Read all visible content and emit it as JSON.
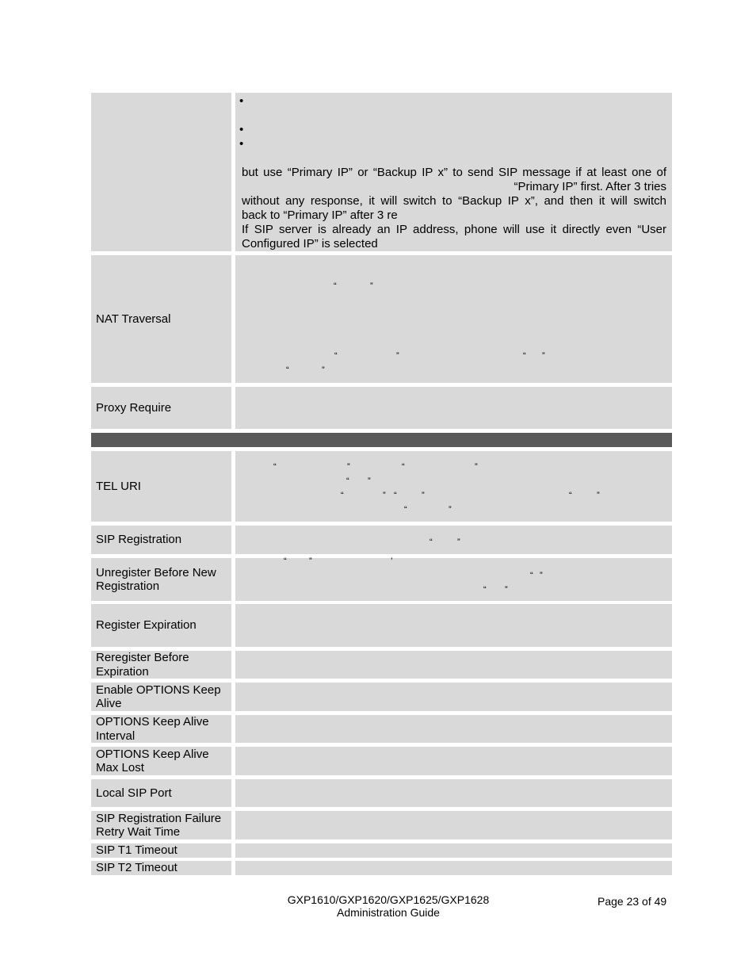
{
  "table": {
    "continuation_row": {
      "bullets": [
        "•",
        "•",
        "•"
      ],
      "lines": [
        "but use “Primary IP” or “Backup IP x” to send SIP message if at least one of",
        "“Primary IP” first. After 3 tries",
        "without any response, it will switch to “Backup IP x”, and then it will switch",
        "back to “Primary IP” after 3 re",
        "If SIP server is already an IP address, phone will use it directly even “User",
        "Configured IP” is selected"
      ]
    },
    "rows": [
      {
        "label": "NAT Traversal"
      },
      {
        "label": "Proxy Require"
      },
      {
        "label": "TEL URI"
      },
      {
        "label": "SIP Registration"
      },
      {
        "label": "Unregister Before New Registration"
      },
      {
        "label": "Register Expiration"
      },
      {
        "label": "Reregister Before Expiration"
      },
      {
        "label": "Enable OPTIONS Keep Alive"
      },
      {
        "label": "OPTIONS Keep Alive Interval"
      },
      {
        "label": "OPTIONS Keep Alive Max Lost"
      },
      {
        "label": "Local SIP Port"
      },
      {
        "label": "SIP Registration Failure Retry Wait Time"
      },
      {
        "label": "SIP T1 Timeout"
      },
      {
        "label": "SIP T2 Timeout"
      }
    ],
    "quote_open": "“",
    "quote_close": "”",
    "apostrophe": "’"
  },
  "footer": {
    "product": "GXP1610/GXP1620/GXP1625/GXP1628",
    "doc_title": "Administration Guide",
    "page": "Page 23 of 49"
  }
}
